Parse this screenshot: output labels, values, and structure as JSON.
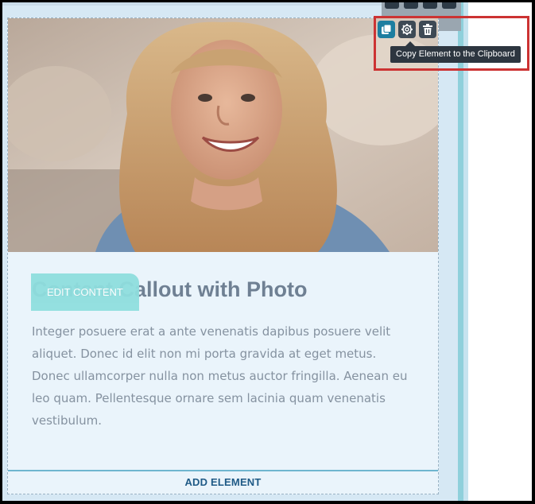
{
  "card": {
    "heading": "Content Callout with Photo",
    "edit_content_label": "EDIT CONTENT",
    "body_text": "Integer posuere erat a ante venenatis dapibus posuere velit aliquet. Donec id elit non mi porta gravida at eget metus. Donec ullamcorper nulla non metus auctor fringilla. Aenean eu leo quam. Pellentesque ornare sem lacinia quam venenatis vestibulum.",
    "add_element_label": "ADD ELEMENT"
  },
  "toolbar": {
    "copy_icon": "copy-icon",
    "settings_icon": "gear-icon",
    "delete_icon": "trash-icon",
    "tooltip": "Copy Element to the Clipboard"
  },
  "colors": {
    "accent": "#1d7ea0",
    "edit_content_bg": "#8fdede",
    "highlight": "#cc3333",
    "add_element_text": "#1f5a86"
  }
}
